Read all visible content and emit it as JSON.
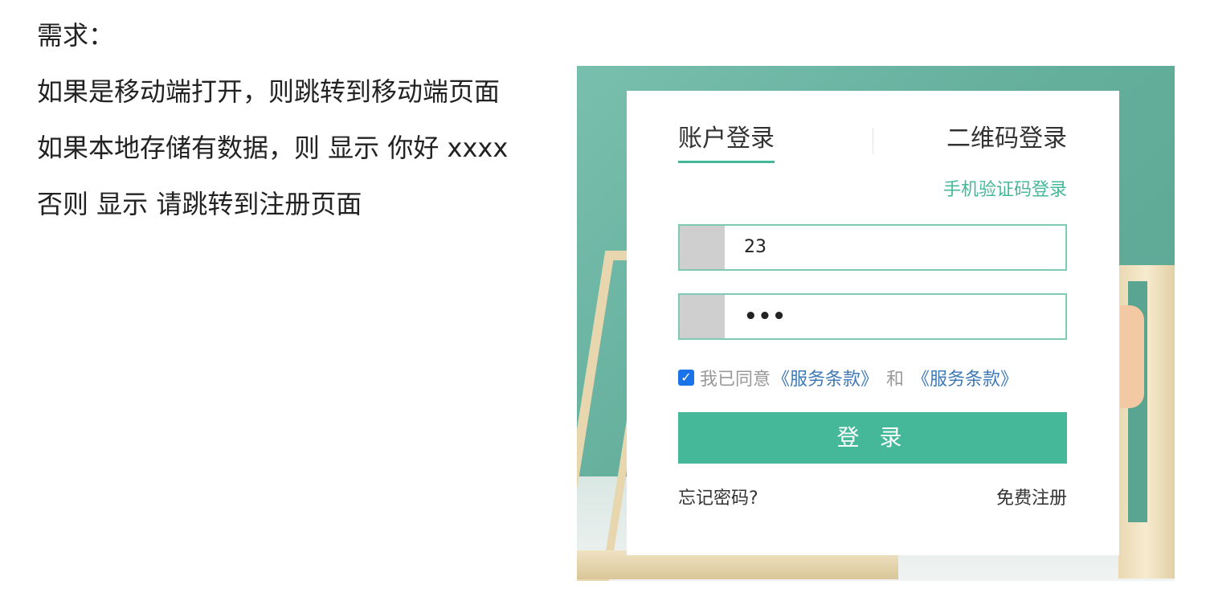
{
  "requirements": {
    "title": "需求：",
    "lines": [
      "如果是移动端打开，则跳转到移动端页面",
      "如果本地存储有数据，则 显示 你好 xxxx",
      "否则 显示 请跳转到注册页面"
    ]
  },
  "login": {
    "tabs": {
      "account": "账户登录",
      "qrcode": "二维码登录"
    },
    "sms_link": "手机验证码登录",
    "username_value": "23",
    "password_value": "•••",
    "agree": {
      "checked": true,
      "text": "我已同意",
      "terms1": "《服务条款》",
      "and": "和",
      "terms2": "《服务条款》"
    },
    "submit_label": "登 录",
    "forgot_label": "忘记密码?",
    "register_label": "免费注册"
  },
  "colors": {
    "accent": "#44b899",
    "link": "#3d79b6",
    "background": "#64ae9c"
  }
}
